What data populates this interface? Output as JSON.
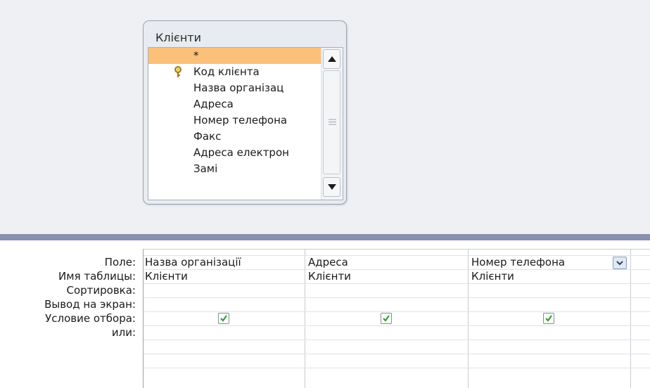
{
  "table": {
    "title": "Клієнти",
    "fields": [
      "*",
      "Код клієнта",
      "Назва організац",
      "Адреса",
      "Номер телефона",
      "Факс",
      "Адреса електрон",
      "Замі"
    ]
  },
  "grid": {
    "row_labels": [
      "Поле:",
      "Имя таблицы:",
      "Сортировка:",
      "Вывод на экран:",
      "Условие отбора:",
      "или:"
    ],
    "columns": [
      {
        "field": "Назва організації",
        "table": "Клієнти",
        "show": true
      },
      {
        "field": "Адреса",
        "table": "Клієнти",
        "show": true
      },
      {
        "field": "Номер телефона",
        "table": "Клієнти",
        "show": true
      }
    ]
  },
  "colors": {
    "selected_row": "#fbc17a",
    "splitter": "#8a90ad",
    "check": "#2ea32e"
  },
  "icons": {
    "key": "key-icon",
    "dropdown": "chevron-down-icon",
    "scroll_up": "arrow-up-icon",
    "scroll_down": "arrow-down-icon",
    "checkmark": "checkmark-icon"
  }
}
